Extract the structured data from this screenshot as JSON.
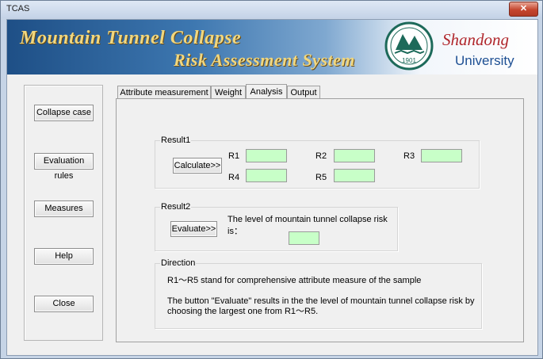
{
  "window": {
    "title": "TCAS",
    "close_glyph": "✕"
  },
  "banner": {
    "line1": "Mountain Tunnel Collapse",
    "line2": "Risk Assessment System",
    "university_name_1": "Shandong",
    "university_name_2": "University",
    "logo_year": "1901"
  },
  "sidebar": {
    "buttons": [
      "Collapse case",
      "Evaluation rules",
      "Measures",
      "Help",
      "Close"
    ]
  },
  "tabs": [
    {
      "label": "Attribute measurement",
      "active": false
    },
    {
      "label": "Weight",
      "active": false
    },
    {
      "label": "Analysis",
      "active": true
    },
    {
      "label": "Output",
      "active": false
    }
  ],
  "result1": {
    "legend": "Result1",
    "button": "Calculate>>",
    "fields": [
      {
        "label": "R1",
        "value": ""
      },
      {
        "label": "R2",
        "value": ""
      },
      {
        "label": "R3",
        "value": ""
      },
      {
        "label": "R4",
        "value": ""
      },
      {
        "label": "R5",
        "value": ""
      }
    ],
    "field_color": "#c8ffc8"
  },
  "result2": {
    "legend": "Result2",
    "button": "Evaluate>>",
    "prompt": "The level of mountain tunnel collapse risk is：",
    "value": ""
  },
  "direction": {
    "legend": "Direction",
    "line1": "R1～R5 stand for comprehensive attribute measure of the sample",
    "line2": "The button \"Evaluate\" results in the the level of  mountain tunnel collapse risk by",
    "line3": "choosing the largest one from R1～R5."
  },
  "colors": {
    "banner_text": "#f1d77e",
    "university_red": "#b0262b",
    "university_blue": "#1d4f93"
  }
}
